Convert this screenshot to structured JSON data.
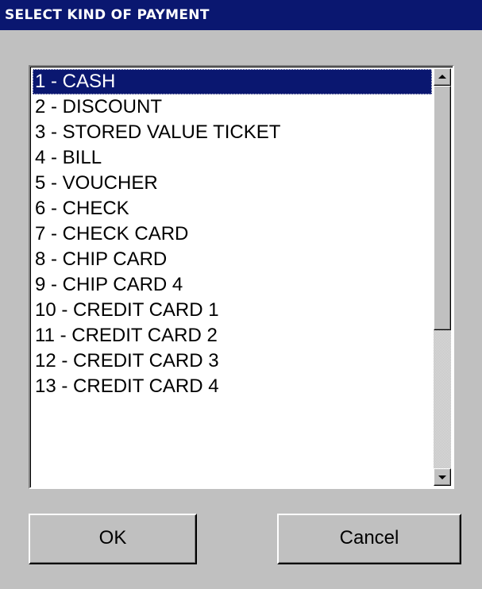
{
  "dialog": {
    "title": "SELECT KIND OF PAYMENT"
  },
  "payment_list": {
    "selected_index": 0,
    "items": [
      "1 - CASH",
      "2 - DISCOUNT",
      "3 - STORED VALUE TICKET",
      "4 - BILL",
      "5 - VOUCHER",
      "6 - CHECK",
      "7 - CHECK CARD",
      "8 - CHIP CARD",
      "9 - CHIP CARD 4",
      "10 - CREDIT CARD 1",
      "11 - CREDIT CARD 2",
      "12 - CREDIT CARD 3",
      "13 - CREDIT CARD 4"
    ]
  },
  "buttons": {
    "ok_label": "OK",
    "cancel_label": "Cancel"
  },
  "colors": {
    "title_bar": "#0a1770",
    "selection": "#0a1770",
    "face": "#c0c0c0"
  }
}
